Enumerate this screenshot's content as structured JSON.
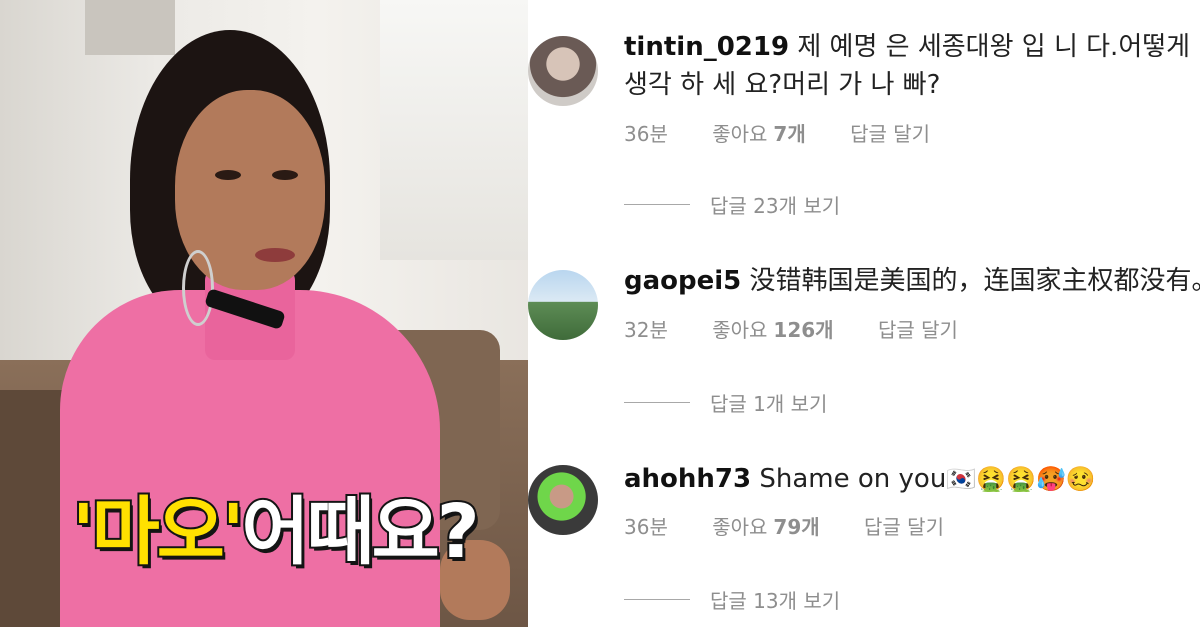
{
  "photo": {
    "caption_highlight": "'마오'",
    "caption_rest": "어때요?"
  },
  "comments": [
    {
      "username": "tintin_0219",
      "text_line1": "제 예명 은 세종대왕 입 니 다.어떻게",
      "text_line2": "생각 하 세 요?머리 가 나 빠?",
      "time": "36분",
      "likes_prefix": "좋아요",
      "likes_count": "7개",
      "reply": "답글 달기",
      "view_replies": "답글 23개 보기"
    },
    {
      "username": "gaopei5",
      "text_line1": "没错韩国是美国的，连国家主权都没有。",
      "time": "32분",
      "likes_prefix": "좋아요",
      "likes_count": "126개",
      "reply": "답글 달기",
      "view_replies": "답글 1개 보기"
    },
    {
      "username": "ahohh73",
      "text_line1": "Shame on you",
      "emojis": "🇰🇷🤮🤮🥵🥴",
      "time": "36분",
      "likes_prefix": "좋아요",
      "likes_count": "79개",
      "reply": "답글 달기",
      "view_replies": "답글 13개 보기"
    }
  ]
}
